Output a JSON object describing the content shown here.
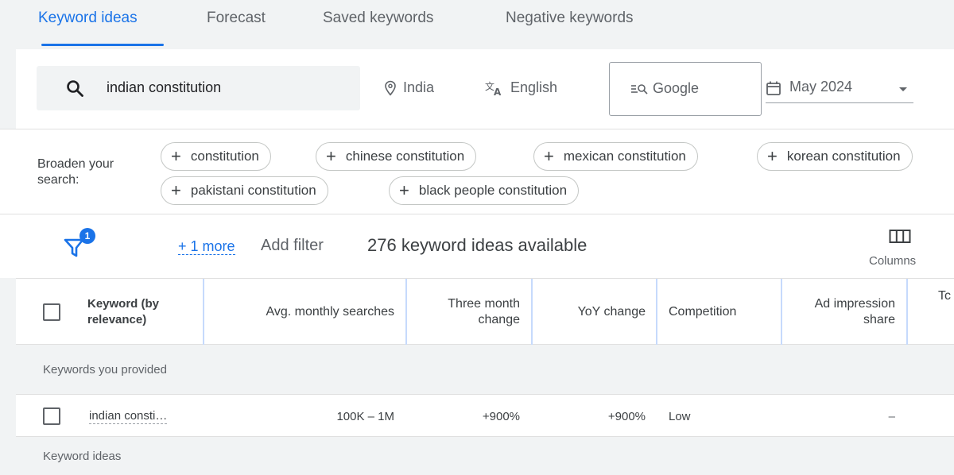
{
  "tabs": [
    {
      "label": "Keyword ideas",
      "active": true
    },
    {
      "label": "Forecast",
      "active": false
    },
    {
      "label": "Saved keywords",
      "active": false
    },
    {
      "label": "Negative keywords",
      "active": false
    }
  ],
  "search": {
    "query": "indian constitution",
    "location": "India",
    "language": "English",
    "network": "Google",
    "date_range": "May 2024"
  },
  "broaden": {
    "label": "Broaden your search:",
    "chips": [
      "constitution",
      "chinese constitution",
      "mexican constitution",
      "korean constitution",
      "pakistani constitution",
      "black people constitution"
    ]
  },
  "filters": {
    "badge_count": "1",
    "more_link": "+ 1 more",
    "add_filter": "Add filter",
    "ideas_available": "276 keyword ideas available",
    "columns_label": "Columns"
  },
  "table": {
    "headers": {
      "keyword": "Keyword (by relevance)",
      "avg_searches": "Avg. monthly searches",
      "three_month": "Three month change",
      "yoy": "YoY change",
      "competition": "Competition",
      "ad_impression": "Ad impression share",
      "cut_off": "Tc"
    },
    "section_provided": "Keywords you provided",
    "rows": [
      {
        "keyword": "indian consti…",
        "avg_searches": "100K – 1M",
        "three_month": "+900%",
        "yoy": "+900%",
        "competition": "Low",
        "ad_impression": "–"
      }
    ],
    "section_ideas": "Keyword ideas"
  },
  "colors": {
    "accent": "#1a73e8",
    "background": "#f1f3f4",
    "divider": "#c6dafc"
  }
}
